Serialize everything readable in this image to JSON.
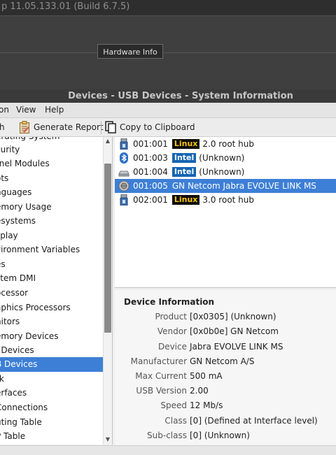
{
  "background_window": {
    "title": "p 11.05.133.01 (Build 6.7.5)",
    "tooltip": "Hardware Info"
  },
  "window": {
    "title": "Devices - USB Devices - System Information"
  },
  "menu": {
    "items": [
      "on",
      "View",
      "Help"
    ]
  },
  "toolbar": {
    "refresh_label": "h",
    "generate_report_label": "Generate Report",
    "copy_label": "Copy to Clipboard"
  },
  "sidebar": {
    "items": [
      {
        "label": "erating System",
        "selected": false
      },
      {
        "label": "curity",
        "selected": false
      },
      {
        "label": "rnel Modules",
        "selected": false
      },
      {
        "label": "ots",
        "selected": false
      },
      {
        "label": "nguages",
        "selected": false
      },
      {
        "label": "emory Usage",
        "selected": false
      },
      {
        "label": "esystems",
        "selected": false
      },
      {
        "label": "splay",
        "selected": false
      },
      {
        "label": "vironment Variables",
        "selected": false
      },
      {
        "label": "es",
        "selected": false
      },
      {
        "label": "stem DMI",
        "selected": false
      },
      {
        "label": "ocessor",
        "selected": false
      },
      {
        "label": "aphics Processors",
        "selected": false
      },
      {
        "label": "nitors",
        "selected": false
      },
      {
        "label": "emory Devices",
        "selected": false
      },
      {
        "label": "I Devices",
        "selected": false
      },
      {
        "label": "B Devices",
        "selected": true
      },
      {
        "label": "rk",
        "selected": false
      },
      {
        "label": "erfaces",
        "selected": false
      },
      {
        "label": "Connections",
        "selected": false
      },
      {
        "label": "uting Table",
        "selected": false
      },
      {
        "label": "P Table",
        "selected": false
      }
    ]
  },
  "devices": [
    {
      "id": "001:001",
      "vendor_badge": "Linux",
      "badge_type": "linux",
      "name": "2.0 root hub",
      "icon": "usb-hub-icon",
      "selected": false
    },
    {
      "id": "001:003",
      "vendor_badge": "Intel",
      "badge_type": "intel",
      "name": "(Unknown)",
      "icon": "bluetooth-icon",
      "selected": false
    },
    {
      "id": "001:004",
      "vendor_badge": "Intel",
      "badge_type": "intel",
      "name": "(Unknown)",
      "icon": "card-reader-icon",
      "selected": false
    },
    {
      "id": "001:005",
      "vendor_badge": "",
      "badge_type": "",
      "name": "GN Netcom Jabra EVOLVE LINK MS",
      "icon": "headset-icon",
      "selected": true
    },
    {
      "id": "002:001",
      "vendor_badge": "Linux",
      "badge_type": "linux",
      "name": "3.0 root hub",
      "icon": "usb-hub-icon",
      "selected": false
    }
  ],
  "device_info": {
    "title": "Device Information",
    "rows": [
      {
        "key": "Product",
        "value": "[0x0305] (Unknown)"
      },
      {
        "key": "Vendor",
        "value": "[0x0b0e] GN Netcom"
      },
      {
        "key": "Device",
        "value": "Jabra EVOLVE LINK MS"
      },
      {
        "key": "Manufacturer",
        "value": "GN Netcom A/S"
      },
      {
        "key": "Max Current",
        "value": "500 mA"
      },
      {
        "key": "USB Version",
        "value": "2.00"
      },
      {
        "key": "Speed",
        "value": "12 Mb/s"
      },
      {
        "key": "Class",
        "value": "[0] (Defined at Interface level)"
      },
      {
        "key": "Sub-class",
        "value": "[0] (Unknown)"
      }
    ]
  },
  "colors": {
    "selection": "#3d7fd6",
    "linux_badge_bg": "#0b0b0b",
    "linux_badge_fg": "#f7c400",
    "intel_badge_bg": "#1565b3"
  }
}
